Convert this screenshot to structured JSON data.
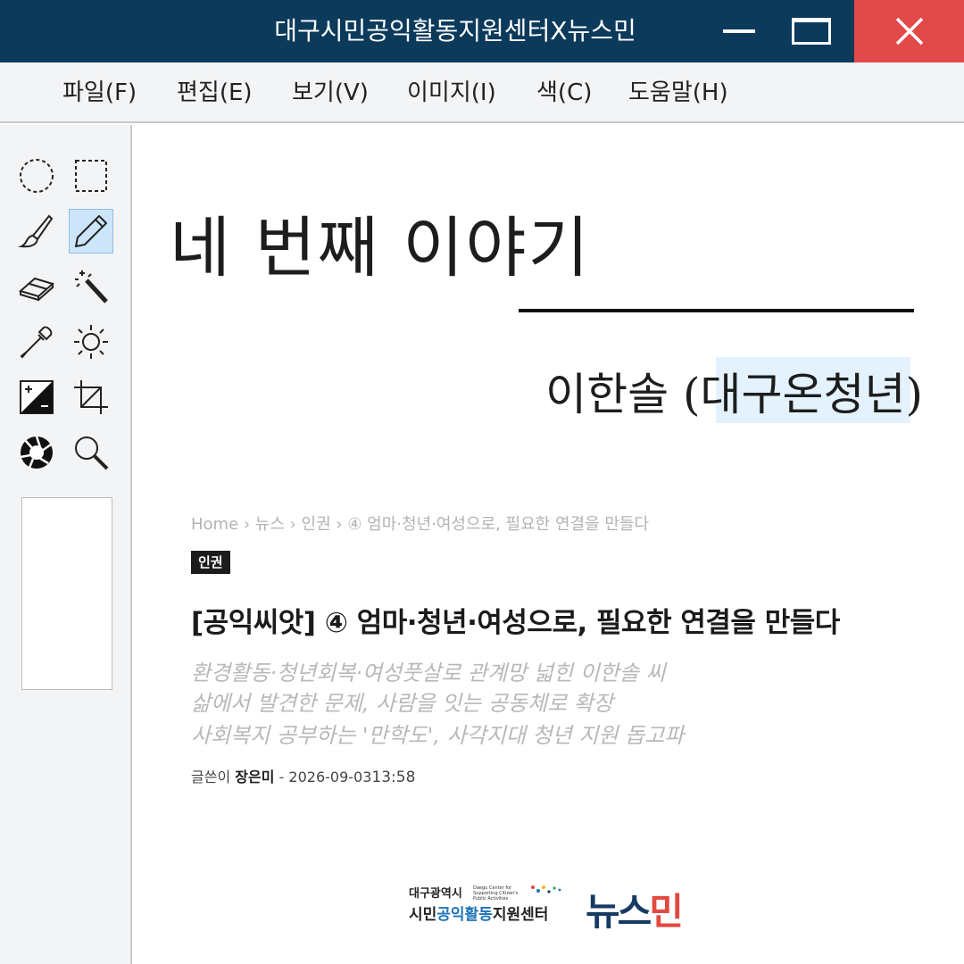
{
  "window": {
    "title": "대구시민공익활동지원센터X뉴스민"
  },
  "menu": [
    {
      "label": "파일(F)"
    },
    {
      "label": "편집(E)"
    },
    {
      "label": "보기(V)"
    },
    {
      "label": "이미지(I)"
    },
    {
      "label": "색(C)"
    },
    {
      "label": "도움말(H)"
    }
  ],
  "tools": [
    {
      "icon": "ellipse-select-icon"
    },
    {
      "icon": "rect-select-icon"
    },
    {
      "icon": "brush-icon"
    },
    {
      "icon": "pencil-icon",
      "selected": true
    },
    {
      "icon": "eraser-icon"
    },
    {
      "icon": "magic-wand-icon"
    },
    {
      "icon": "eyedropper-icon"
    },
    {
      "icon": "brightness-icon"
    },
    {
      "icon": "contrast-icon"
    },
    {
      "icon": "crop-icon"
    },
    {
      "icon": "aperture-icon"
    },
    {
      "icon": "zoom-icon"
    }
  ],
  "colors": {
    "titlebar": "#0c3a5b",
    "close_button": "#e24a4a",
    "selection_highlight": "#e3f2fc"
  },
  "canvas": {
    "heading": "네 번째 이야기",
    "author": "이한솔 (대구온청년)",
    "breadcrumb": "Home  ›  뉴스  ›  인권  ›  ④ 엄마·청년·여성으로, 필요한 연결을 만들다",
    "category_tag": "인권",
    "article_title": "[공익씨앗] ④ 엄마·청년·여성으로, 필요한 연결을 만들다",
    "subtitles": [
      "환경활동·청년회복·여성풋살로 관계망 넓힌 이한솔 씨",
      "삶에서 발견한 문제, 사람을 잇는 공동체로 확장",
      "사회복지 공부하는 '만학도', 사각지대 청년 지원 돕고파"
    ],
    "byline_prefix": "글쓴이",
    "byline_name": "장은미",
    "byline_sep": "-",
    "byline_date": "2026-09-03",
    "byline_time": "13:58",
    "logo_left_line1": "대구광역시",
    "logo_left_small": "Daegu Center for Supporting Citizen's Public Activities",
    "logo_left_line2_a": "시민",
    "logo_left_line2_b": "공익활동",
    "logo_left_line2_c": "지원센터",
    "logo_right_a": "뉴스",
    "logo_right_b": "민"
  }
}
